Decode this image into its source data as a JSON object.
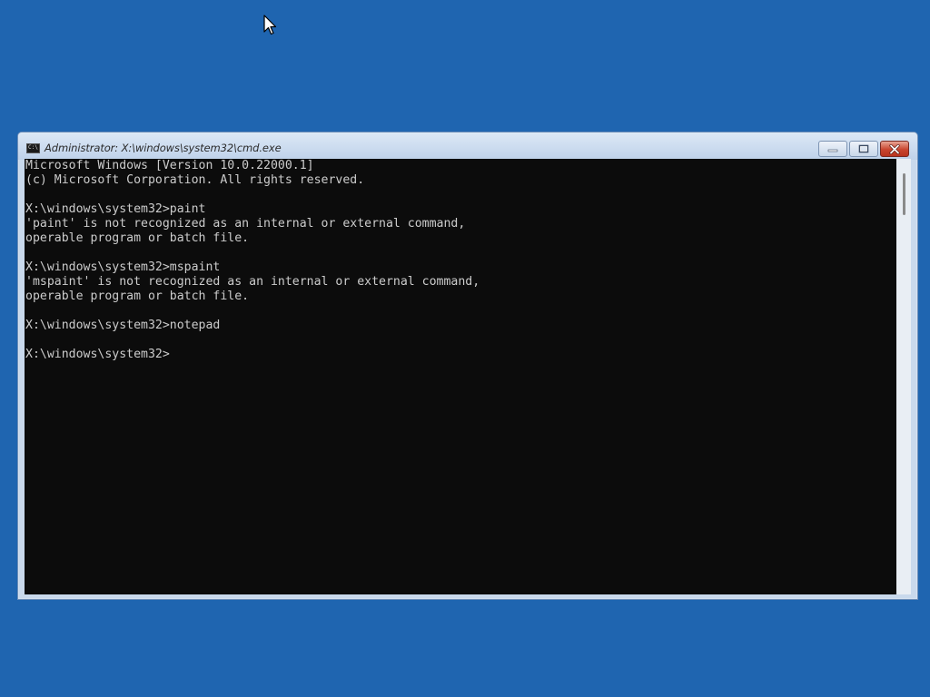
{
  "window": {
    "title": "Administrator: X:\\windows\\system32\\cmd.exe",
    "title_icon_text": "C:\\",
    "controls": {
      "minimize": "minimize-icon",
      "maximize": "maximize-icon",
      "close": "close-icon"
    }
  },
  "console": {
    "lines": [
      "Microsoft Windows [Version 10.0.22000.1]",
      "(c) Microsoft Corporation. All rights reserved.",
      "",
      "X:\\windows\\system32>paint",
      "'paint' is not recognized as an internal or external command,",
      "operable program or batch file.",
      "",
      "X:\\windows\\system32>mspaint",
      "'mspaint' is not recognized as an internal or external command,",
      "operable program or batch file.",
      "",
      "X:\\windows\\system32>notepad",
      "",
      "X:\\windows\\system32>"
    ]
  },
  "colors": {
    "desktop": "#1f65b0",
    "console_background": "#0c0c0c",
    "console_text": "#cccccc"
  }
}
